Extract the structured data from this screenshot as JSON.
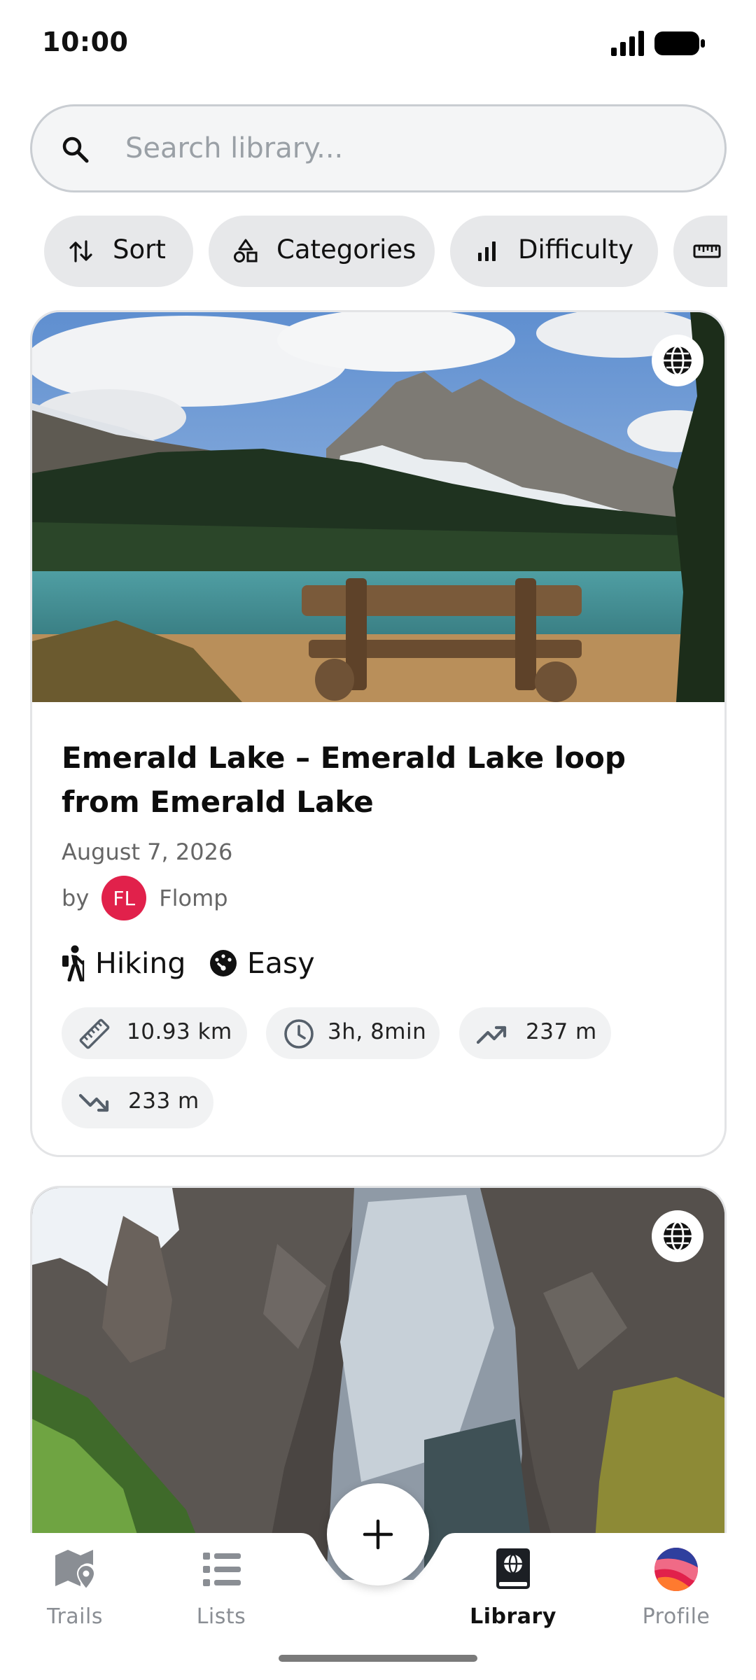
{
  "status_bar": {
    "time": "10:00"
  },
  "search": {
    "placeholder": "Search library..."
  },
  "filters": [
    {
      "label": "Sort",
      "icon": "sort-icon"
    },
    {
      "label": "Categories",
      "icon": "categories-icon"
    },
    {
      "label": "Difficulty",
      "icon": "difficulty-icon"
    },
    {
      "label": "",
      "icon": "ruler-icon"
    }
  ],
  "cards": [
    {
      "title": "Emerald Lake – Emerald Lake loop from Emerald Lake",
      "date": "August 7, 2026",
      "by_label": "by",
      "author_initials": "FL",
      "author": "Flomp",
      "visibility_icon": "globe-icon",
      "activity": "Hiking",
      "difficulty": "Easy",
      "stats": {
        "distance": "10.93 km",
        "duration": "3h, 8min",
        "ascent": "237 m",
        "descent": "233 m"
      }
    },
    {
      "visibility_icon": "globe-icon"
    }
  ],
  "nav": {
    "items": [
      {
        "label": "Trails",
        "icon": "map-pin-icon"
      },
      {
        "label": "Lists",
        "icon": "list-icon"
      },
      {
        "label": "Library",
        "icon": "library-book-icon",
        "active": true
      },
      {
        "label": "Profile",
        "icon": "profile-avatar-icon"
      }
    ],
    "fab_icon": "plus-icon"
  },
  "colors": {
    "avatar": "#e1214b",
    "chip_bg": "#e7e8ea",
    "active_nav": "#111111",
    "inactive_nav": "#8a8e94"
  }
}
